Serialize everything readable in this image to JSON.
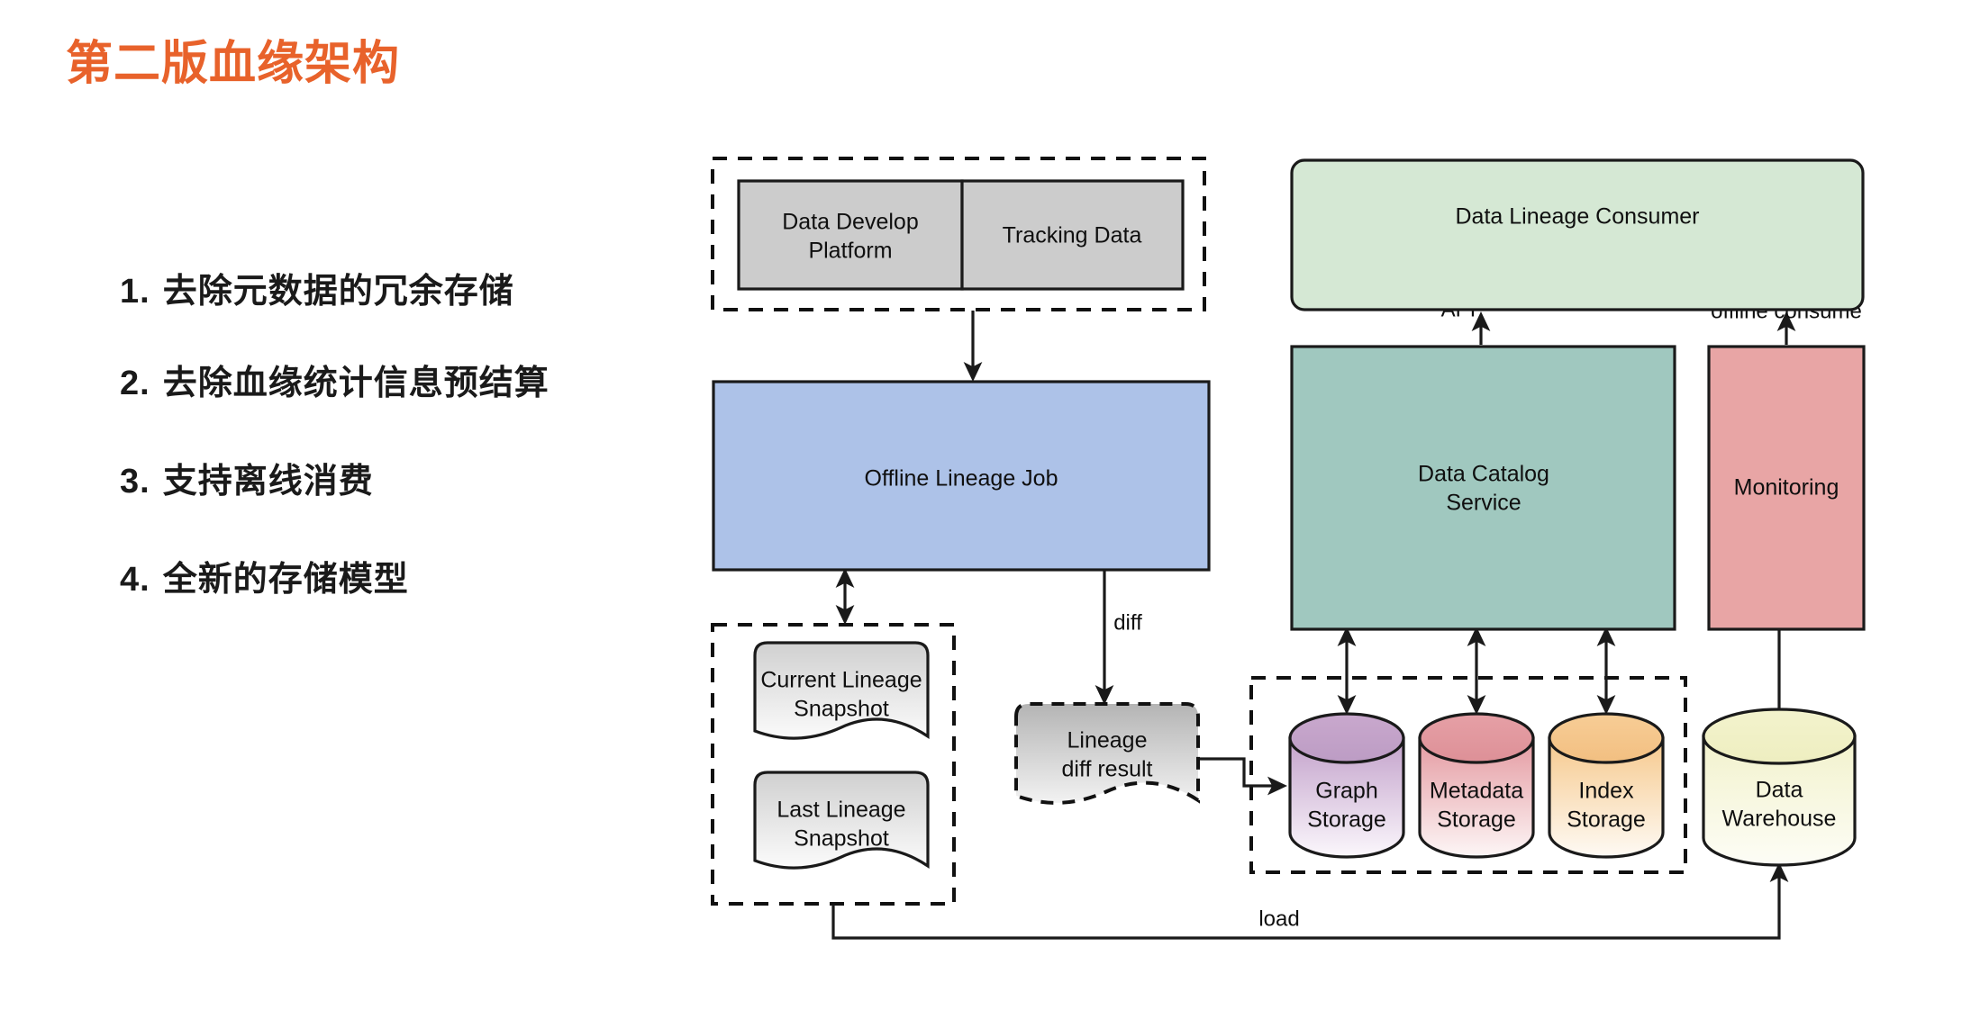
{
  "slide": {
    "title": "第二版血缘架构",
    "title_color": "#e8622b",
    "bullets": [
      {
        "num": "1.",
        "text": "去除元数据的冗余存储"
      },
      {
        "num": "2.",
        "text": "去除血缘统计信息预结算"
      },
      {
        "num": "3.",
        "text": "支持离线消费"
      },
      {
        "num": "4.",
        "text": "全新的存储模型"
      }
    ]
  },
  "diagram": {
    "nodes": {
      "data_develop_platform": {
        "label_line1": "Data Develop",
        "label_line2": "Platform",
        "color": "#cccccc"
      },
      "tracking_data": {
        "label": "Tracking Data",
        "color": "#cccccc"
      },
      "offline_lineage_job": {
        "label": "Offline Lineage Job",
        "color": "#adc2e8"
      },
      "current_lineage_snapshot": {
        "label_line1": "Current Lineage",
        "label_line2": "Snapshot",
        "color": "#e8e8e8"
      },
      "last_lineage_snapshot": {
        "label_line1": "Last Lineage",
        "label_line2": "Snapshot",
        "color": "#e8e8e8"
      },
      "lineage_diff_result": {
        "label_line1": "Lineage",
        "label_line2": "diff result",
        "color": "#c8c8c8"
      },
      "data_lineage_consumer": {
        "label": "Data Lineage Consumer",
        "color": "#d5e8d4"
      },
      "data_catalog_service": {
        "label_line1": "Data Catalog",
        "label_line2": "Service",
        "color": "#a0c8bf"
      },
      "monitoring": {
        "label": "Monitoring",
        "color": "#e8a5a5"
      },
      "graph_storage": {
        "label_line1": "Graph",
        "label_line2": "Storage",
        "color": "#c9a8cd"
      },
      "metadata_storage": {
        "label_line1": "Metadata",
        "label_line2": "Storage",
        "color": "#e6a0a6"
      },
      "index_storage": {
        "label_line1": "Index",
        "label_line2": "Storage",
        "color": "#f5c98f"
      },
      "data_warehouse": {
        "label_line1": "Data",
        "label_line2": "Warehouse",
        "color": "#f0f0c0"
      }
    },
    "edges": {
      "api": "API",
      "offline_consume": "offline consume",
      "diff": "diff",
      "load": "load"
    }
  }
}
